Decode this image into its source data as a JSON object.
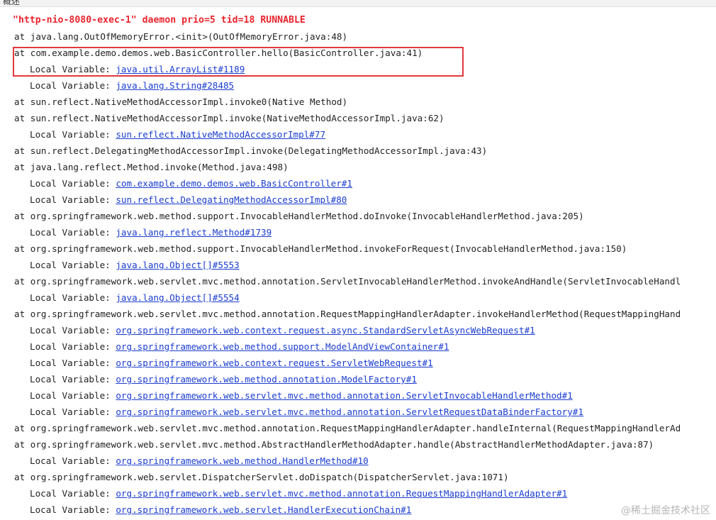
{
  "topbar": {
    "label": "概述"
  },
  "thread_header": "\"http-nio-8080-exec-1\" daemon prio=5 tid=18 RUNNABLE",
  "local_prefix": "Local Variable: ",
  "trace": [
    {
      "kind": "frame",
      "text": "at java.lang.OutOfMemoryError.<init>(OutOfMemoryError.java:48)"
    },
    {
      "kind": "frame",
      "text": "at com.example.demo.demos.web.BasicController.hello(BasicController.java:41)"
    },
    {
      "kind": "local",
      "ref": "java.util.ArrayList#1189"
    },
    {
      "kind": "local",
      "ref": "java.lang.String#28485"
    },
    {
      "kind": "frame",
      "text": "at sun.reflect.NativeMethodAccessorImpl.invoke0(Native Method)"
    },
    {
      "kind": "frame",
      "text": "at sun.reflect.NativeMethodAccessorImpl.invoke(NativeMethodAccessorImpl.java:62)"
    },
    {
      "kind": "local",
      "ref": "sun.reflect.NativeMethodAccessorImpl#77"
    },
    {
      "kind": "frame",
      "text": "at sun.reflect.DelegatingMethodAccessorImpl.invoke(DelegatingMethodAccessorImpl.java:43)"
    },
    {
      "kind": "frame",
      "text": "at java.lang.reflect.Method.invoke(Method.java:498)"
    },
    {
      "kind": "local",
      "ref": "com.example.demo.demos.web.BasicController#1"
    },
    {
      "kind": "local",
      "ref": "sun.reflect.DelegatingMethodAccessorImpl#80"
    },
    {
      "kind": "frame",
      "text": "at org.springframework.web.method.support.InvocableHandlerMethod.doInvoke(InvocableHandlerMethod.java:205)"
    },
    {
      "kind": "local",
      "ref": "java.lang.reflect.Method#1739"
    },
    {
      "kind": "frame",
      "text": "at org.springframework.web.method.support.InvocableHandlerMethod.invokeForRequest(InvocableHandlerMethod.java:150)"
    },
    {
      "kind": "local",
      "ref": "java.lang.Object[]#5553"
    },
    {
      "kind": "frame",
      "text": "at org.springframework.web.servlet.mvc.method.annotation.ServletInvocableHandlerMethod.invokeAndHandle(ServletInvocableHandl"
    },
    {
      "kind": "local",
      "ref": "java.lang.Object[]#5554"
    },
    {
      "kind": "frame",
      "text": "at org.springframework.web.servlet.mvc.method.annotation.RequestMappingHandlerAdapter.invokeHandlerMethod(RequestMappingHand"
    },
    {
      "kind": "local",
      "ref": "org.springframework.web.context.request.async.StandardServletAsyncWebRequest#1"
    },
    {
      "kind": "local",
      "ref": "org.springframework.web.method.support.ModelAndViewContainer#1"
    },
    {
      "kind": "local",
      "ref": "org.springframework.web.context.request.ServletWebRequest#1"
    },
    {
      "kind": "local",
      "ref": "org.springframework.web.method.annotation.ModelFactory#1"
    },
    {
      "kind": "local",
      "ref": "org.springframework.web.servlet.mvc.method.annotation.ServletInvocableHandlerMethod#1"
    },
    {
      "kind": "local",
      "ref": "org.springframework.web.servlet.mvc.method.annotation.ServletRequestDataBinderFactory#1"
    },
    {
      "kind": "frame",
      "text": "at org.springframework.web.servlet.mvc.method.annotation.RequestMappingHandlerAdapter.handleInternal(RequestMappingHandlerAd"
    },
    {
      "kind": "frame",
      "text": "at org.springframework.web.servlet.mvc.method.AbstractHandlerMethodAdapter.handle(AbstractHandlerMethodAdapter.java:87)"
    },
    {
      "kind": "local",
      "ref": "org.springframework.web.method.HandlerMethod#10"
    },
    {
      "kind": "frame",
      "text": "at org.springframework.web.servlet.DispatcherServlet.doDispatch(DispatcherServlet.java:1071)"
    },
    {
      "kind": "local",
      "ref": "org.springframework.web.servlet.mvc.method.annotation.RequestMappingHandlerAdapter#1"
    },
    {
      "kind": "local",
      "ref": "org.springframework.web.servlet.HandlerExecutionChain#1"
    }
  ],
  "watermark": "@稀土掘金技术社区",
  "colors": {
    "thread_header": "#e8242e",
    "link": "#1a3ccf",
    "highlight_box": "#e0393e"
  }
}
